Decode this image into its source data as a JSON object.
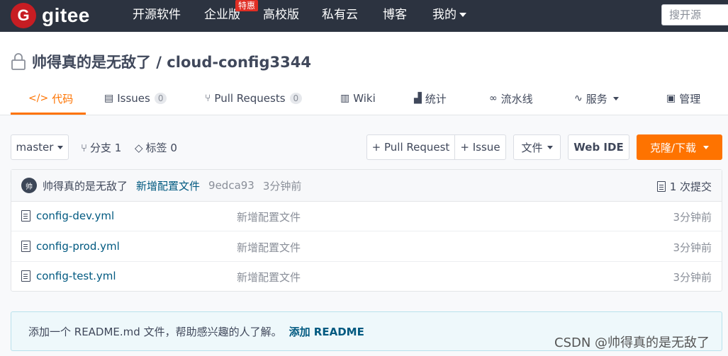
{
  "nav": {
    "brand": "gitee",
    "logo_letter": "G",
    "items": [
      "开源软件",
      "企业版",
      "高校版",
      "私有云",
      "博客",
      "我的"
    ],
    "hot_badge": "特惠",
    "search_placeholder": "搜开源"
  },
  "repo": {
    "title": "帅得真的是无敌了 / cloud-config3344"
  },
  "tabs": [
    {
      "label": "代码",
      "icon": "code-icon"
    },
    {
      "label": "Issues",
      "count": "0",
      "icon": "issues-icon"
    },
    {
      "label": "Pull Requests",
      "count": "0",
      "icon": "pull-request-icon"
    },
    {
      "label": "Wiki",
      "icon": "wiki-icon"
    },
    {
      "label": "统计",
      "icon": "stats-icon"
    },
    {
      "label": "流水线",
      "icon": "pipeline-icon"
    },
    {
      "label": "服务",
      "icon": "service-icon"
    },
    {
      "label": "管理",
      "icon": "manage-icon"
    }
  ],
  "toolbar": {
    "branch": "master",
    "branches_label": "分支 1",
    "tags_label": "标签 0",
    "pull_request_btn": "+ Pull Request",
    "issue_btn": "+ Issue",
    "file_btn": "文件",
    "webide_btn": "Web IDE",
    "clone_btn": "克隆/下载"
  },
  "commit": {
    "avatar_text": "帅",
    "author": "帅得真的是无敌了",
    "message": "新增配置文件",
    "hash": "9edca93",
    "time": "3分钟前",
    "commits_label": "1 次提交"
  },
  "files": [
    {
      "name": "config-dev.yml",
      "message": "新增配置文件",
      "time": "3分钟前"
    },
    {
      "name": "config-prod.yml",
      "message": "新增配置文件",
      "time": "3分钟前"
    },
    {
      "name": "config-test.yml",
      "message": "新增配置文件",
      "time": "3分钟前"
    }
  ],
  "readme": {
    "text": "添加一个 README.md 文件，帮助感兴趣的人了解。",
    "link": "添加 README"
  },
  "watermark": "CSDN @帅得真的是无敌了",
  "colors": {
    "nav_bg": "#2c3340",
    "accent": "#fe7300",
    "brand_red": "#c71d23",
    "link": "#005980"
  }
}
